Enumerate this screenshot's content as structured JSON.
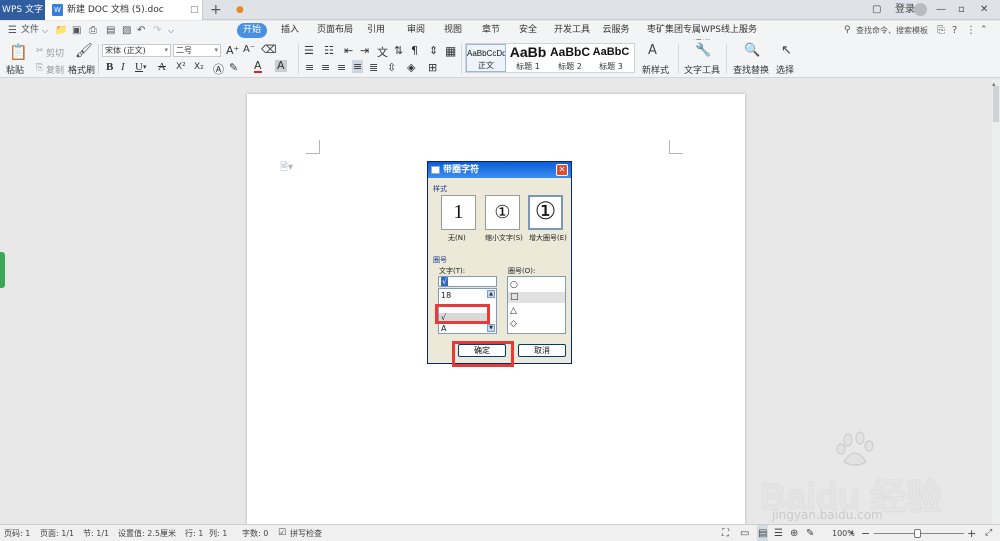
{
  "titlebar": {
    "app_tab": "WPS 文字",
    "doc_tab": "新建 DOC 文档 (5).doc",
    "add_tab": "+",
    "login": "登录"
  },
  "menubar": {
    "file": "文件",
    "tabs": [
      "开始",
      "插入",
      "页面布局",
      "引用",
      "审阅",
      "视图",
      "章节",
      "安全",
      "开发工具",
      "云服务",
      "枣矿集团专属WPS线上服务通道"
    ],
    "active_tab": "开始",
    "search_label": "查找命令、搜索模板",
    "help": "?"
  },
  "ribbon": {
    "paste": "粘贴",
    "cut": "剪切",
    "copy": "复制",
    "format_painter": "格式刷",
    "font_name": "宋体 (正文)",
    "font_size": "二号",
    "bold": "B",
    "italic": "I",
    "underline": "U",
    "strikethrough": "A",
    "superscript": "X²",
    "subscript": "X₂",
    "font_color": "A",
    "highlight": "A",
    "styles": [
      {
        "sample": "AaBbCcDd",
        "label": "正文"
      },
      {
        "sample": "AaBb",
        "label": "标题 1"
      },
      {
        "sample": "AaBbC",
        "label": "标题 2"
      },
      {
        "sample": "AaBbC",
        "label": "标题 3"
      }
    ],
    "new_style": "新样式",
    "text_tools": "文字工具",
    "find_replace": "查找替换",
    "select": "选择"
  },
  "dialog": {
    "title": "带圈字符",
    "close": "✕",
    "style_group": "样式",
    "style_options": [
      {
        "glyph": "1",
        "label": "无(N)",
        "selected": false
      },
      {
        "glyph": "①",
        "label": "缩小文字(S)",
        "selected": false
      },
      {
        "glyph": "①",
        "label": "增大圈号(E)",
        "selected": true
      }
    ],
    "circle_group": "圈号",
    "text_label": "文字(T):",
    "text_value": "√",
    "text_list": [
      "18",
      "",
      "√",
      "A"
    ],
    "enclosure_label": "圈号(O):",
    "enclosure_list": [
      "○",
      "□",
      "△",
      "◇"
    ],
    "ok": "确定",
    "cancel": "取消"
  },
  "statusbar": {
    "page_num": "页码: 1",
    "pages": "页面: 1/1",
    "section": "节: 1/1",
    "setting": "设置值: 2.5厘米",
    "row": "行: 1",
    "col": "列: 1",
    "words": "字数: 0",
    "spell": "拼写检查",
    "zoom": "100%",
    "zoom_minus": "−",
    "zoom_plus": "+"
  },
  "watermark": {
    "brand": "Baidu 经验",
    "url": "jingyan.baidu.com"
  },
  "colors": {
    "accent": "#4a90e2",
    "app_tab": "#2f5d9e",
    "dialog_title": "#0a5fd8",
    "highlight_box": "#e53b3b"
  }
}
